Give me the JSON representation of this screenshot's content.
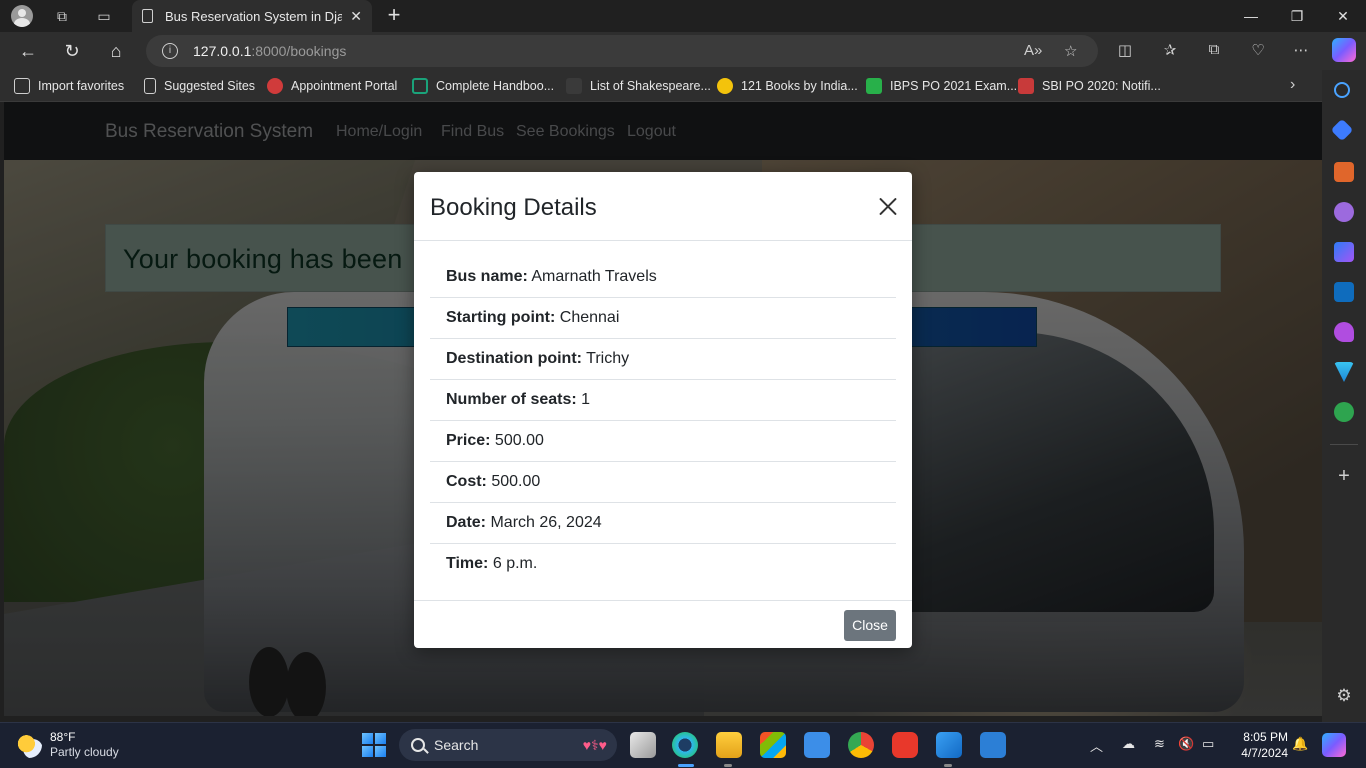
{
  "browser": {
    "tab_title": "Bus Reservation System in Djang",
    "tab_close": "✕",
    "new_tab": "+",
    "url_host": "127.0.0.1",
    "url_path": ":8000/bookings",
    "window_controls": {
      "minimize": "—",
      "maximize": "❐",
      "close": "✕"
    }
  },
  "favorites": [
    {
      "label": "Import favorites",
      "color": "#cfcfcf"
    },
    {
      "label": "Suggested Sites",
      "color": "#d0d0d0"
    },
    {
      "label": "Appointment Portal",
      "color": "#d03b3b"
    },
    {
      "label": "Complete Handboo...",
      "color": "#1aa37a"
    },
    {
      "label": "List of Shakespeare...",
      "color": "#4a4a4a"
    },
    {
      "label": "121 Books by India...",
      "color": "#f3c30c"
    },
    {
      "label": "IBPS PO 2021 Exam...",
      "color": "#28b04a"
    },
    {
      "label": "SBI PO 2020: Notifi...",
      "color": "#c83a3a"
    }
  ],
  "app": {
    "brand": "Bus Reservation System",
    "nav": [
      "Home/Login",
      "Find Bus",
      "See Bookings",
      "Logout"
    ],
    "alert_text": "Your booking has been"
  },
  "modal": {
    "title": "Booking Details",
    "rows": [
      {
        "label": "Bus name:",
        "value": "Amarnath Travels"
      },
      {
        "label": "Starting point:",
        "value": "Chennai"
      },
      {
        "label": "Destination point:",
        "value": "Trichy"
      },
      {
        "label": "Number of seats:",
        "value": "1"
      },
      {
        "label": "Price:",
        "value": "500.00"
      },
      {
        "label": "Cost:",
        "value": "500.00"
      },
      {
        "label": "Date:",
        "value": "March 26, 2024"
      },
      {
        "label": "Time:",
        "value": "6 p.m."
      }
    ],
    "close_label": "Close"
  },
  "taskbar": {
    "weather_temp": "88°F",
    "weather_desc": "Partly cloudy",
    "search_label": "Search",
    "time": "8:05 PM",
    "date": "4/7/2024"
  },
  "colors": {
    "modal_bg": "#ffffff",
    "close_button": "#6c757d",
    "alert_bg": "#7b8f86",
    "navbar": "#1c1e20"
  }
}
